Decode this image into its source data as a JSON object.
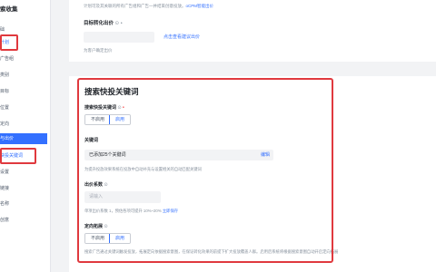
{
  "sidebar": {
    "title": "索收集",
    "items": [
      {
        "label": "础",
        "style": "normal"
      },
      {
        "label": "计划",
        "style": "blue"
      },
      {
        "label": "广告组",
        "style": "normal"
      },
      {
        "label": "类别",
        "style": "normal"
      },
      {
        "label": "目标",
        "style": "normal"
      },
      {
        "label": "位置",
        "style": "normal"
      },
      {
        "label": "定向",
        "style": "normal"
      },
      {
        "label": "与出价",
        "style": "active"
      },
      {
        "label": "快投关键词",
        "style": "blue"
      },
      {
        "label": "设置",
        "style": "normal"
      },
      {
        "label": "链接",
        "style": "normal"
      },
      {
        "label": "名称",
        "style": "normal"
      },
      {
        "label": "创意",
        "style": "normal"
      }
    ]
  },
  "top_section": {
    "note_prefix": "计划可及其关联的所有广告组和广告一并结束创意投放。",
    "note_link": "oCPM智能出价",
    "target_label": "目标转化出价",
    "target_info": "⊙",
    "target_req": "•",
    "suggest_link": "点击查看建议出价",
    "sub_note": "为客户确定出价"
  },
  "search_section": {
    "title": "搜索快投关键词",
    "toggle_label": "搜索快投关键词",
    "toggle_info": "⊙",
    "toggle_req": "•",
    "toggle_options": [
      "不启用",
      "启用"
    ],
    "toggle_selected": "启用",
    "keywords_label": "关键词",
    "keywords_value": "已添加25个关键词",
    "keywords_edit": "编辑",
    "keywords_hint": "为提升投放效果系统在投放中自动补充与设置相关的自动匹配关键词",
    "bid_label": "出价系数",
    "bid_info": "⊙",
    "bid_placeholder": "请输入",
    "bid_hint_prefix": "单项出价系数 1，预估各项可提升 10%~20%",
    "bid_hint_link": "立即保存",
    "expand_label": "定向拓展",
    "expand_info": "⊙",
    "expand_options": [
      "不启用",
      "启用"
    ],
    "expand_selected": "启用",
    "expand_hint": "搜索广告通过关键词触发投放，拓展定向依据搜索意图，在保证转化效果的前提下扩大投放覆盖人群。启用后系统将根据搜索意图自动开启定向拓展"
  },
  "colors": {
    "accent": "#3370ff",
    "highlight": "#e0393e",
    "required": "#f53f3f"
  }
}
